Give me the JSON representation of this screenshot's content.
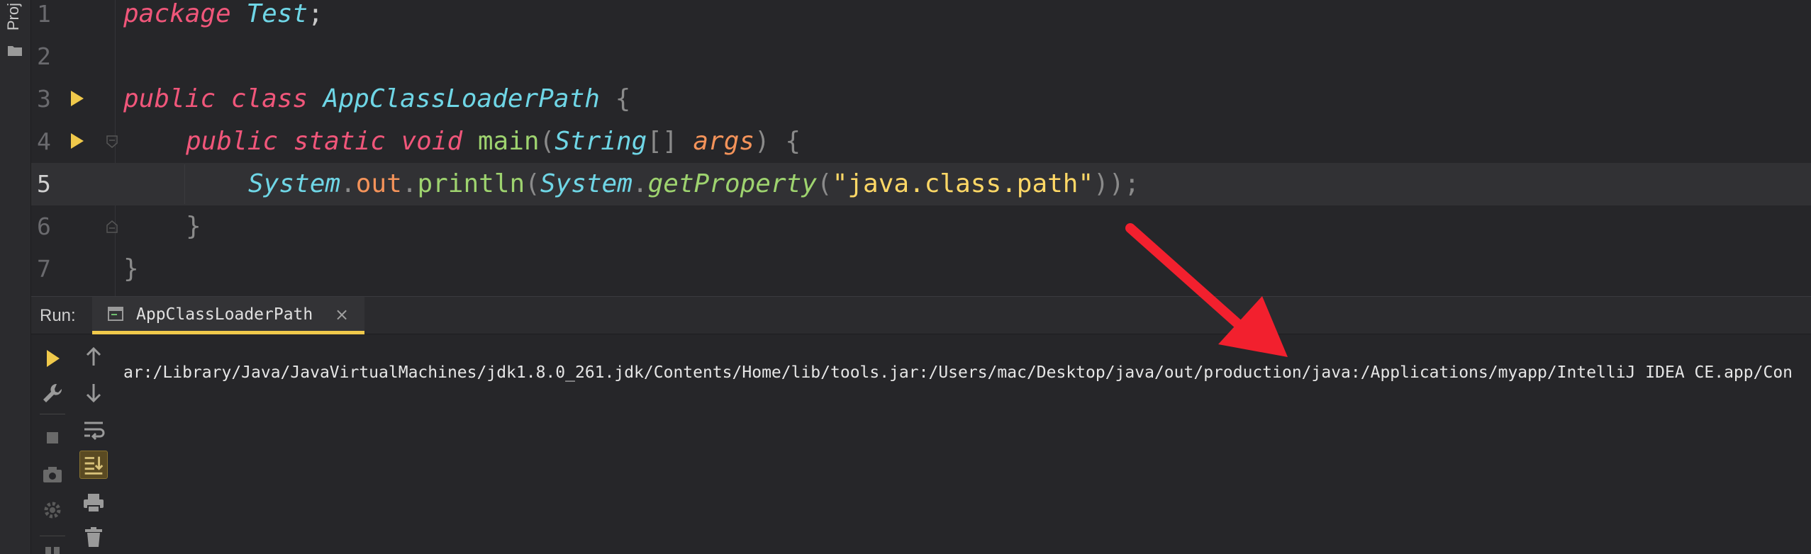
{
  "side_strip": {
    "label": "Proj"
  },
  "editor": {
    "line_numbers": [
      "1",
      "2",
      "3",
      "4",
      "5",
      "6",
      "7"
    ],
    "line1": {
      "kw": "package",
      "pkg": "Test",
      "semi": ";"
    },
    "line3": {
      "kw1": "public",
      "kw2": "class",
      "name": "AppClassLoaderPath",
      "brace": "{"
    },
    "line4": {
      "kw1": "public",
      "kw2": "static",
      "kw3": "void",
      "fn": "main",
      "open": "(",
      "type": "String",
      "brackets": "[]",
      "param": "args",
      "close": ")",
      "brace": "{"
    },
    "line5": {
      "cls1": "System",
      "dot1": ".",
      "field": "out",
      "dot2": ".",
      "fn": "println",
      "open1": "(",
      "cls2": "System",
      "dot3": ".",
      "fn2": "getProperty",
      "open2": "(",
      "str": "\"java.class.path\"",
      "close": "));"
    },
    "line6": {
      "brace": "}"
    },
    "line7": {
      "brace": "}"
    },
    "current_line": 5
  },
  "run_panel": {
    "title": "Run:",
    "tab_label": "AppClassLoaderPath",
    "tab_close": "×",
    "output": "ar:/Library/Java/JavaVirtualMachines/jdk1.8.0_261.jdk/Contents/Home/lib/tools.jar:/Users/mac/Desktop/java/out/production/java:/Applications/myapp/IntelliJ IDEA CE.app/Con"
  },
  "icons": {
    "run": "play-icon",
    "settings": "wrench-icon",
    "stop": "stop-icon",
    "snapshot": "camera-icon",
    "debug": "gear-icon",
    "up": "arrow-up-icon",
    "down": "arrow-down-icon",
    "wrap": "soft-wrap-icon",
    "scroll_end": "scroll-to-end-icon",
    "print": "print-icon",
    "delete": "trash-icon"
  },
  "colors": {
    "keyword": "#f0567a",
    "class": "#6fd6e6",
    "function": "#9ed36f",
    "field": "#f4935a",
    "string": "#ffd866",
    "run_arrow": "#f0c94b",
    "annotation_arrow": "#f2202e"
  }
}
